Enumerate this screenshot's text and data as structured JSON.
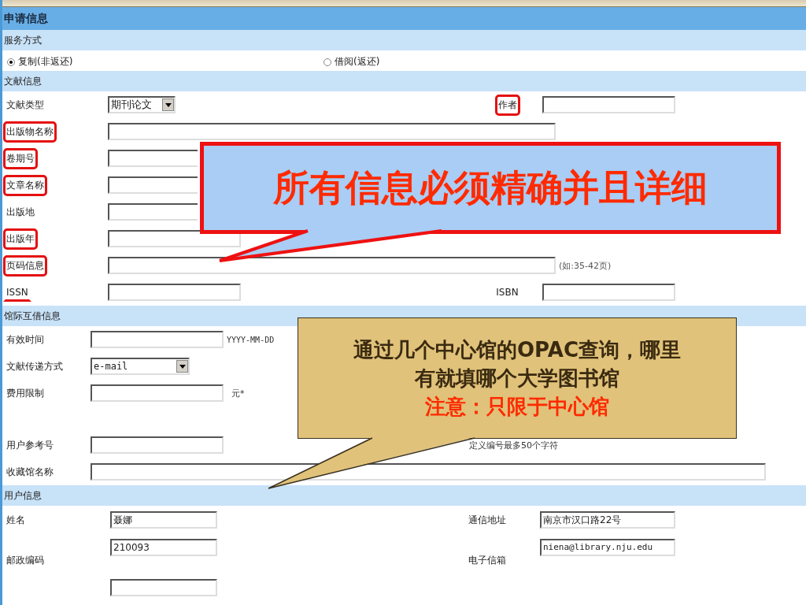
{
  "title": "申请信息",
  "service": {
    "heading": "服务方式",
    "options": [
      {
        "label": "复制(非返还)",
        "selected": true
      },
      {
        "label": "借阅(返还)",
        "selected": false
      }
    ]
  },
  "sections": [
    {
      "kind": "document",
      "heading": "文献信息",
      "rows": [
        {
          "label": "文献类型",
          "boxed": false,
          "underlined": false,
          "field": {
            "kind": "select",
            "value": "期刊论文"
          },
          "right_label": "作者",
          "right_boxed": true,
          "right_field": {
            "kind": "text"
          }
        },
        {
          "label": "出版物名称",
          "boxed": true,
          "underlined": false,
          "field": {
            "kind": "text"
          }
        },
        {
          "label": "卷期号",
          "boxed": true,
          "underlined": false,
          "field": {
            "kind": "text"
          }
        },
        {
          "label": "文章名称",
          "boxed": true,
          "underlined": false,
          "field": {
            "kind": "text"
          }
        },
        {
          "label": "出版地",
          "boxed": false,
          "underlined": false,
          "field": {
            "kind": "text"
          }
        },
        {
          "label": "出版年",
          "boxed": true,
          "underlined": false,
          "field": {
            "kind": "text"
          }
        },
        {
          "label": "页码信息",
          "boxed": true,
          "underlined": false,
          "field": {
            "kind": "text"
          },
          "hint": "(如:35-42页)"
        },
        {
          "label": "ISSN",
          "boxed": false,
          "underlined": true,
          "field": {
            "kind": "text"
          },
          "right_label": "ISBN",
          "right_boxed": false,
          "right_field": {
            "kind": "text"
          }
        }
      ]
    },
    {
      "kind": "loan",
      "heading": "馆际互借信息",
      "rows": [
        {
          "label": "有效时间",
          "boxed": false,
          "underlined": false,
          "field": {
            "kind": "text"
          },
          "hint": "YYYY-MM-DD"
        },
        {
          "label": "文献传递方式",
          "boxed": false,
          "underlined": false,
          "field": {
            "kind": "select",
            "value": "e-mail"
          }
        },
        {
          "label": "费用限制",
          "boxed": false,
          "underlined": false,
          "field": {
            "kind": "text"
          },
          "hint": "元*"
        },
        {
          "label": "用户参考号",
          "boxed": false,
          "underlined": false,
          "field": {
            "kind": "text"
          },
          "hint": "定义编号最多50个字符"
        },
        {
          "label": "收藏馆名称",
          "boxed": false,
          "underlined": false,
          "field": {
            "kind": "text"
          }
        }
      ]
    },
    {
      "kind": "user",
      "heading": "用户信息",
      "rows": [
        {
          "label": "姓名",
          "boxed": false,
          "underlined": false,
          "field": {
            "kind": "text",
            "value": "聂娜"
          },
          "right_label": "通信地址",
          "right_boxed": false,
          "right_field": {
            "kind": "text",
            "value": "南京市汉口路22号"
          }
        },
        {
          "label": "邮政编码",
          "boxed": false,
          "underlined": false,
          "field": {
            "kind": "text",
            "value": "210093"
          },
          "right_label": "电子信箱",
          "right_boxed": false,
          "right_field": {
            "kind": "text",
            "value": "niena@library.nju.edu"
          }
        },
        {
          "field": {
            "kind": "text"
          }
        }
      ]
    }
  ],
  "callouts": [
    {
      "kind": "banner",
      "lines": [
        {
          "text": "所有信息必须精确并且详细",
          "emphasis": true
        }
      ]
    },
    {
      "kind": "note",
      "lines": [
        {
          "text": "通过几个中心馆的OPAC查询，哪里",
          "emphasis": false
        },
        {
          "text": "有就填哪个大学图书馆",
          "emphasis": false
        },
        {
          "text": "注意：只限于中心馆",
          "emphasis": true
        }
      ]
    }
  ]
}
